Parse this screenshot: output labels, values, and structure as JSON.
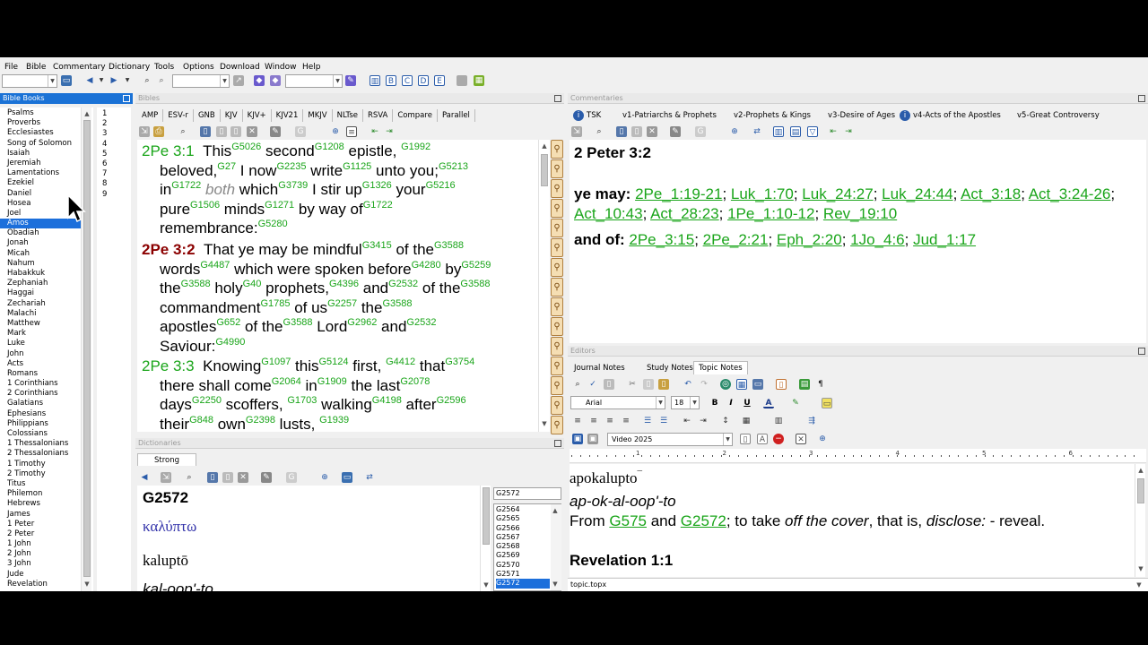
{
  "menu": [
    "File",
    "Bible",
    "Commentary",
    "Dictionary",
    "Tools",
    "Options",
    "Download",
    "Window",
    "Help"
  ],
  "panels": {
    "books_title": "Bible Books",
    "bibles_title": "Bibles",
    "commentaries_title": "Commentaries",
    "dictionaries_title": "Dictionaries",
    "editors_title": "Editors"
  },
  "books": [
    "Psalms",
    "Proverbs",
    "Ecclesiastes",
    "Song of Solomon",
    "Isaiah",
    "Jeremiah",
    "Lamentations",
    "Ezekiel",
    "Daniel",
    "Hosea",
    "Joel",
    "Amos",
    "Obadiah",
    "Jonah",
    "Micah",
    "Nahum",
    "Habakkuk",
    "Zephaniah",
    "Haggai",
    "Zechariah",
    "Malachi",
    "Matthew",
    "Mark",
    "Luke",
    "John",
    "Acts",
    "Romans",
    "1 Corinthians",
    "2 Corinthians",
    "Galatians",
    "Ephesians",
    "Philippians",
    "Colossians",
    "1 Thessalonians",
    "2 Thessalonians",
    "1 Timothy",
    "2 Timothy",
    "Titus",
    "Philemon",
    "Hebrews",
    "James",
    "1 Peter",
    "2 Peter",
    "1 John",
    "2 John",
    "3 John",
    "Jude",
    "Revelation"
  ],
  "selected_book": "Amos",
  "chapters": [
    "1",
    "2",
    "3",
    "4",
    "5",
    "6",
    "7",
    "8",
    "9"
  ],
  "bible_tabs": [
    "AMP",
    "ESV-r",
    "GNB",
    "KJV",
    "KJV+",
    "KJV21",
    "MKJV",
    "NLTse",
    "RSVA",
    "Compare",
    "Parallel"
  ],
  "verses": {
    "v1": {
      "ref": "2Pe 3:1",
      "l1": [
        [
          "w",
          "This"
        ],
        [
          "s",
          "G5026"
        ],
        [
          "w",
          " second"
        ],
        [
          "s",
          "G1208"
        ],
        [
          "w",
          " epistle, "
        ],
        [
          "s",
          "G1992"
        ]
      ],
      "l2": [
        [
          "w",
          "beloved,"
        ],
        [
          "s",
          "G27"
        ],
        [
          "w",
          " I now"
        ],
        [
          "s",
          "G2235"
        ],
        [
          "w",
          " write"
        ],
        [
          "s",
          "G1125"
        ],
        [
          "w",
          " unto you;"
        ],
        [
          "s",
          "G5213"
        ]
      ],
      "l3": [
        [
          "w",
          "in"
        ],
        [
          "s",
          "G1722"
        ],
        [
          "i",
          " both"
        ],
        [
          "w",
          " which"
        ],
        [
          "s",
          "G3739"
        ],
        [
          "w",
          " I stir up"
        ],
        [
          "s",
          "G1326"
        ],
        [
          "w",
          " your"
        ],
        [
          "s",
          "G5216"
        ]
      ],
      "l4": [
        [
          "w",
          "pure"
        ],
        [
          "s",
          "G1506"
        ],
        [
          "w",
          " minds"
        ],
        [
          "s",
          "G1271"
        ],
        [
          "w",
          " by way of"
        ],
        [
          "s",
          "G1722"
        ]
      ],
      "l5": [
        [
          "w",
          "remembrance:"
        ],
        [
          "s",
          "G5280"
        ]
      ]
    },
    "v2": {
      "ref": "2Pe 3:2",
      "l1": [
        [
          "w",
          "That ye may be mindful"
        ],
        [
          "s",
          "G3415"
        ],
        [
          "w",
          " of the"
        ],
        [
          "s",
          "G3588"
        ]
      ],
      "l2": [
        [
          "w",
          "words"
        ],
        [
          "s",
          "G4487"
        ],
        [
          "w",
          " which were spoken before"
        ],
        [
          "s",
          "G4280"
        ],
        [
          "w",
          " by"
        ],
        [
          "s",
          "G5259"
        ]
      ],
      "l3": [
        [
          "w",
          "the"
        ],
        [
          "s",
          "G3588"
        ],
        [
          "w",
          " holy"
        ],
        [
          "s",
          "G40"
        ],
        [
          "w",
          " prophets,"
        ],
        [
          "s",
          "G4396"
        ],
        [
          "w",
          " and"
        ],
        [
          "s",
          "G2532"
        ],
        [
          "w",
          " of the"
        ],
        [
          "s",
          "G3588"
        ]
      ],
      "l4": [
        [
          "w",
          "commandment"
        ],
        [
          "s",
          "G1785"
        ],
        [
          "w",
          " of us"
        ],
        [
          "s",
          "G2257"
        ],
        [
          "w",
          " the"
        ],
        [
          "s",
          "G3588"
        ]
      ],
      "l5": [
        [
          "w",
          "apostles"
        ],
        [
          "s",
          "G652"
        ],
        [
          "w",
          " of the"
        ],
        [
          "s",
          "G3588"
        ],
        [
          "w",
          " Lord"
        ],
        [
          "s",
          "G2962"
        ],
        [
          "w",
          " and"
        ],
        [
          "s",
          "G2532"
        ]
      ],
      "l6": [
        [
          "w",
          "Saviour:"
        ],
        [
          "s",
          "G4990"
        ]
      ]
    },
    "v3": {
      "ref": "2Pe 3:3",
      "l1": [
        [
          "w",
          "Knowing"
        ],
        [
          "s",
          "G1097"
        ],
        [
          "w",
          " this"
        ],
        [
          "s",
          "G5124"
        ],
        [
          "w",
          " first, "
        ],
        [
          "s",
          "G4412"
        ],
        [
          "w",
          " that"
        ],
        [
          "s",
          "G3754"
        ]
      ],
      "l2": [
        [
          "w",
          "there shall come"
        ],
        [
          "s",
          "G2064"
        ],
        [
          "w",
          " in"
        ],
        [
          "s",
          "G1909"
        ],
        [
          "w",
          " the last"
        ],
        [
          "s",
          "G2078"
        ]
      ],
      "l3": [
        [
          "w",
          "days"
        ],
        [
          "s",
          "G2250"
        ],
        [
          "w",
          " scoffers, "
        ],
        [
          "s",
          "G1703"
        ],
        [
          "w",
          " walking"
        ],
        [
          "s",
          "G4198"
        ],
        [
          "w",
          " after"
        ],
        [
          "s",
          "G2596"
        ]
      ],
      "l4": [
        [
          "w",
          "their"
        ],
        [
          "s",
          "G848"
        ],
        [
          "w",
          " own"
        ],
        [
          "s",
          "G2398"
        ],
        [
          "w",
          " lusts, "
        ],
        [
          "s",
          "G1939"
        ]
      ]
    }
  },
  "commentary_tabs": [
    "TSK",
    "v1-Patriarchs & Prophets",
    "v2-Prophets & Kings",
    "v3-Desire of Ages",
    "v4-Acts of the Apostles",
    "v5-Great Controversy"
  ],
  "commentary": {
    "heading": "2 Peter 3:2",
    "p1_label": "ye may:",
    "p1_refs": [
      "2Pe_1:19-21",
      "Luk_1:70",
      "Luk_24:27",
      "Luk_24:44",
      "Act_3:18",
      "Act_3:24-26",
      "Act_10:43",
      "Act_28:23",
      "1Pe_1:10-12",
      "Rev_19:10"
    ],
    "p2_label": "and of:",
    "p2_refs": [
      "2Pe_3:15",
      "2Pe_2:21",
      "Eph_2:20",
      "1Jo_4:6",
      "Jud_1:17"
    ]
  },
  "dictionary": {
    "tab": "Strong",
    "entry": "G2572",
    "greek": "καλύπτω",
    "translit": "kaluptō",
    "pron": "kal-oop'-to",
    "search": "G2572",
    "keys": [
      "G2564",
      "G2565",
      "G2566",
      "G2567",
      "G2568",
      "G2569",
      "G2570",
      "G2571",
      "G2572"
    ]
  },
  "editor": {
    "tabs": [
      "Journal Notes",
      "Study Notes",
      "Topic Notes"
    ],
    "active_tab": "Topic Notes",
    "font": "Arial",
    "size": "18",
    "style": "Video 2025",
    "ruler_marks": [
      "1",
      "2",
      "3",
      "4",
      "5",
      "6",
      "7"
    ],
    "word": "apokalupto",
    "pron": "ap-ok-al-oop'-to",
    "def_pre": "From ",
    "def_ref1": "G575",
    "def_and": " and ",
    "def_ref2": "G2572",
    "def_mid": "; to take ",
    "def_it1": "off the cover",
    "def_mid2": ", that is, ",
    "def_it2": "disclose:",
    "def_end": " - reveal.",
    "next_heading": "Revelation 1:1",
    "status_file": "topic.topx"
  },
  "colors": {
    "green": "#1aa51a",
    "accent": "#1c6fdb",
    "verse_red": "#8b0000",
    "greek": "#3333aa"
  }
}
